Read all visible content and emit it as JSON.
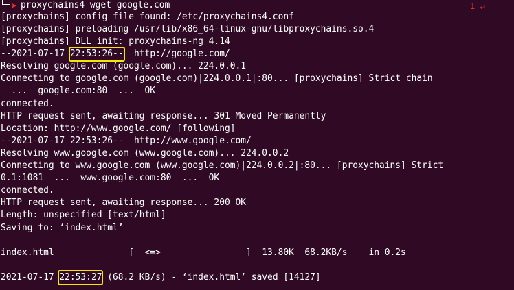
{
  "prompt": {
    "command": "proxychains4 wget google.com",
    "exit_status": "1 ↵"
  },
  "output": {
    "l1": "[proxychains] config file found: /etc/proxychains4.conf",
    "l2": "[proxychains] preloading /usr/lib/x86_64-linux-gnu/libproxychains.so.4",
    "l3": "[proxychains] DLL init: proxychains-ng 4.14",
    "l4_date": "--2021-07-17 ",
    "l4_time": "22:53:26--",
    "l4_rest": "  http://google.com/",
    "l5": "Resolving google.com (google.com)... 224.0.0.1",
    "l6": "Connecting to google.com (google.com)|224.0.0.1|:80... [proxychains] Strict chain",
    "l7": "  ...  google.com:80  ...  OK",
    "l8": "connected.",
    "l9": "HTTP request sent, awaiting response... 301 Moved Permanently",
    "l10": "Location: http://www.google.com/ [following]",
    "l11": "--2021-07-17 22:53:26--  http://www.google.com/",
    "l12": "Resolving www.google.com (www.google.com)... 224.0.0.2",
    "l13": "Connecting to www.google.com (www.google.com)|224.0.0.2|:80... [proxychains] Strict",
    "l14": "0.1:1081  ...  www.google.com:80  ...  OK",
    "l15": "connected.",
    "l16": "HTTP request sent, awaiting response... 200 OK",
    "l17": "Length: unspecified [text/html]",
    "l18": "Saving to: ‘index.html’",
    "l19": "index.html              [  <=>                ]  13.80K  68.2KB/s    in 0.2s",
    "l20_date": "2021-07-17 ",
    "l20_time": "22:53:27",
    "l20_rest": " (68.2 KB/s) - ‘index.html’ saved [14127]"
  },
  "colors": {
    "background": "#300a24",
    "text": "#ffffff",
    "prompt_accent": "#e0302c",
    "highlight_box": "#f7e400"
  }
}
